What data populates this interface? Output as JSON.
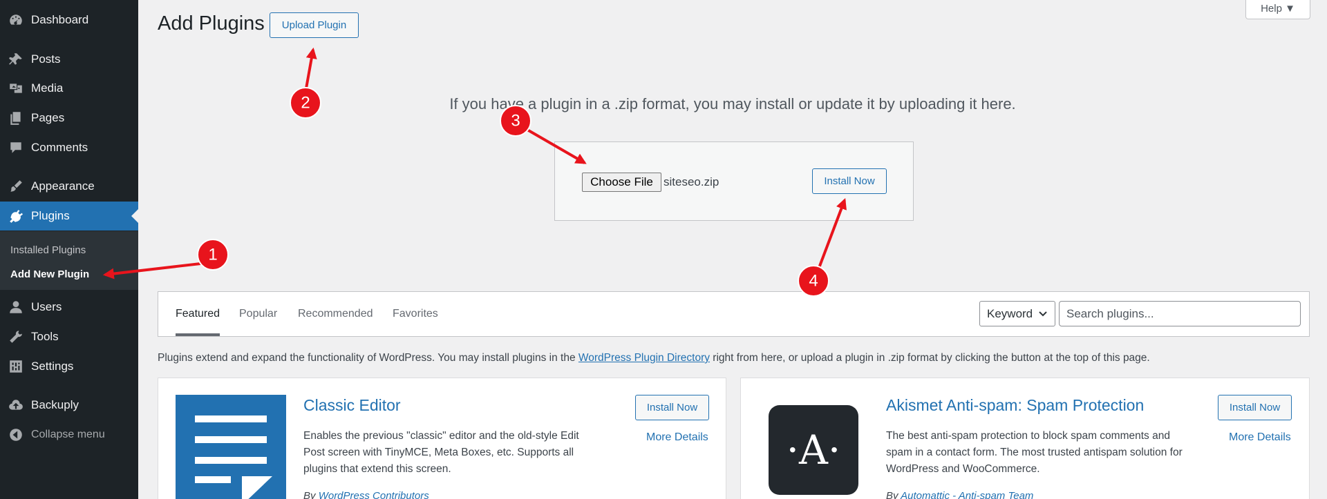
{
  "sidebar": {
    "items": [
      {
        "label": "Dashboard",
        "icon": "dashboard-icon"
      },
      {
        "label": "Posts",
        "icon": "pin-icon"
      },
      {
        "label": "Media",
        "icon": "media-icon"
      },
      {
        "label": "Pages",
        "icon": "pages-icon"
      },
      {
        "label": "Comments",
        "icon": "comment-icon"
      },
      {
        "label": "Appearance",
        "icon": "brush-icon"
      },
      {
        "label": "Plugins",
        "icon": "plugin-icon",
        "current": true
      },
      {
        "label": "Users",
        "icon": "user-icon"
      },
      {
        "label": "Tools",
        "icon": "wrench-icon"
      },
      {
        "label": "Settings",
        "icon": "settings-icon"
      },
      {
        "label": "Backuply",
        "icon": "cloud-upload-icon"
      }
    ],
    "submenu": [
      {
        "label": "Installed Plugins"
      },
      {
        "label": "Add New Plugin",
        "current": true
      }
    ],
    "collapse_label": "Collapse menu"
  },
  "header": {
    "title": "Add Plugins",
    "upload_button": "Upload Plugin",
    "help_label": "Help ▼"
  },
  "upload": {
    "description": "If you have a plugin in a .zip format, you may install or update it by uploading it here.",
    "choose_file_label": "Choose File",
    "file_name": "siteseo.zip",
    "install_button": "Install Now"
  },
  "filter": {
    "tabs": [
      "Featured",
      "Popular",
      "Recommended",
      "Favorites"
    ],
    "active_tab": "Featured",
    "search_type": "Keyword",
    "search_placeholder": "Search plugins..."
  },
  "intro": {
    "before": "Plugins extend and expand the functionality of WordPress. You may install plugins in the ",
    "link": "WordPress Plugin Directory",
    "after": " right from here, or upload a plugin in .zip format by clicking the button at the top of this page."
  },
  "cards": [
    {
      "name": "Classic Editor",
      "description": "Enables the previous \"classic\" editor and the old-style Edit Post screen with TinyMCE, Meta Boxes, etc. Supports all plugins that extend this screen.",
      "by_prefix": "By ",
      "author": "WordPress Contributors",
      "install_label": "Install Now",
      "more_label": "More Details"
    },
    {
      "name": "Akismet Anti-spam: Spam Protection",
      "description": "The best anti-spam protection to block spam comments and spam in a contact form. The most trusted antispam solution for WordPress and WooCommerce.",
      "by_prefix": "By ",
      "author": "Automattic - Anti-spam Team",
      "install_label": "Install Now",
      "more_label": "More Details",
      "logo_letter": "·A·"
    }
  ],
  "annotations": {
    "color": "#e8141c",
    "badges": [
      "1",
      "2",
      "3",
      "4"
    ]
  },
  "colors": {
    "accent": "#2271b1",
    "sidebar_bg": "#1d2327",
    "background": "#f0f0f1"
  }
}
